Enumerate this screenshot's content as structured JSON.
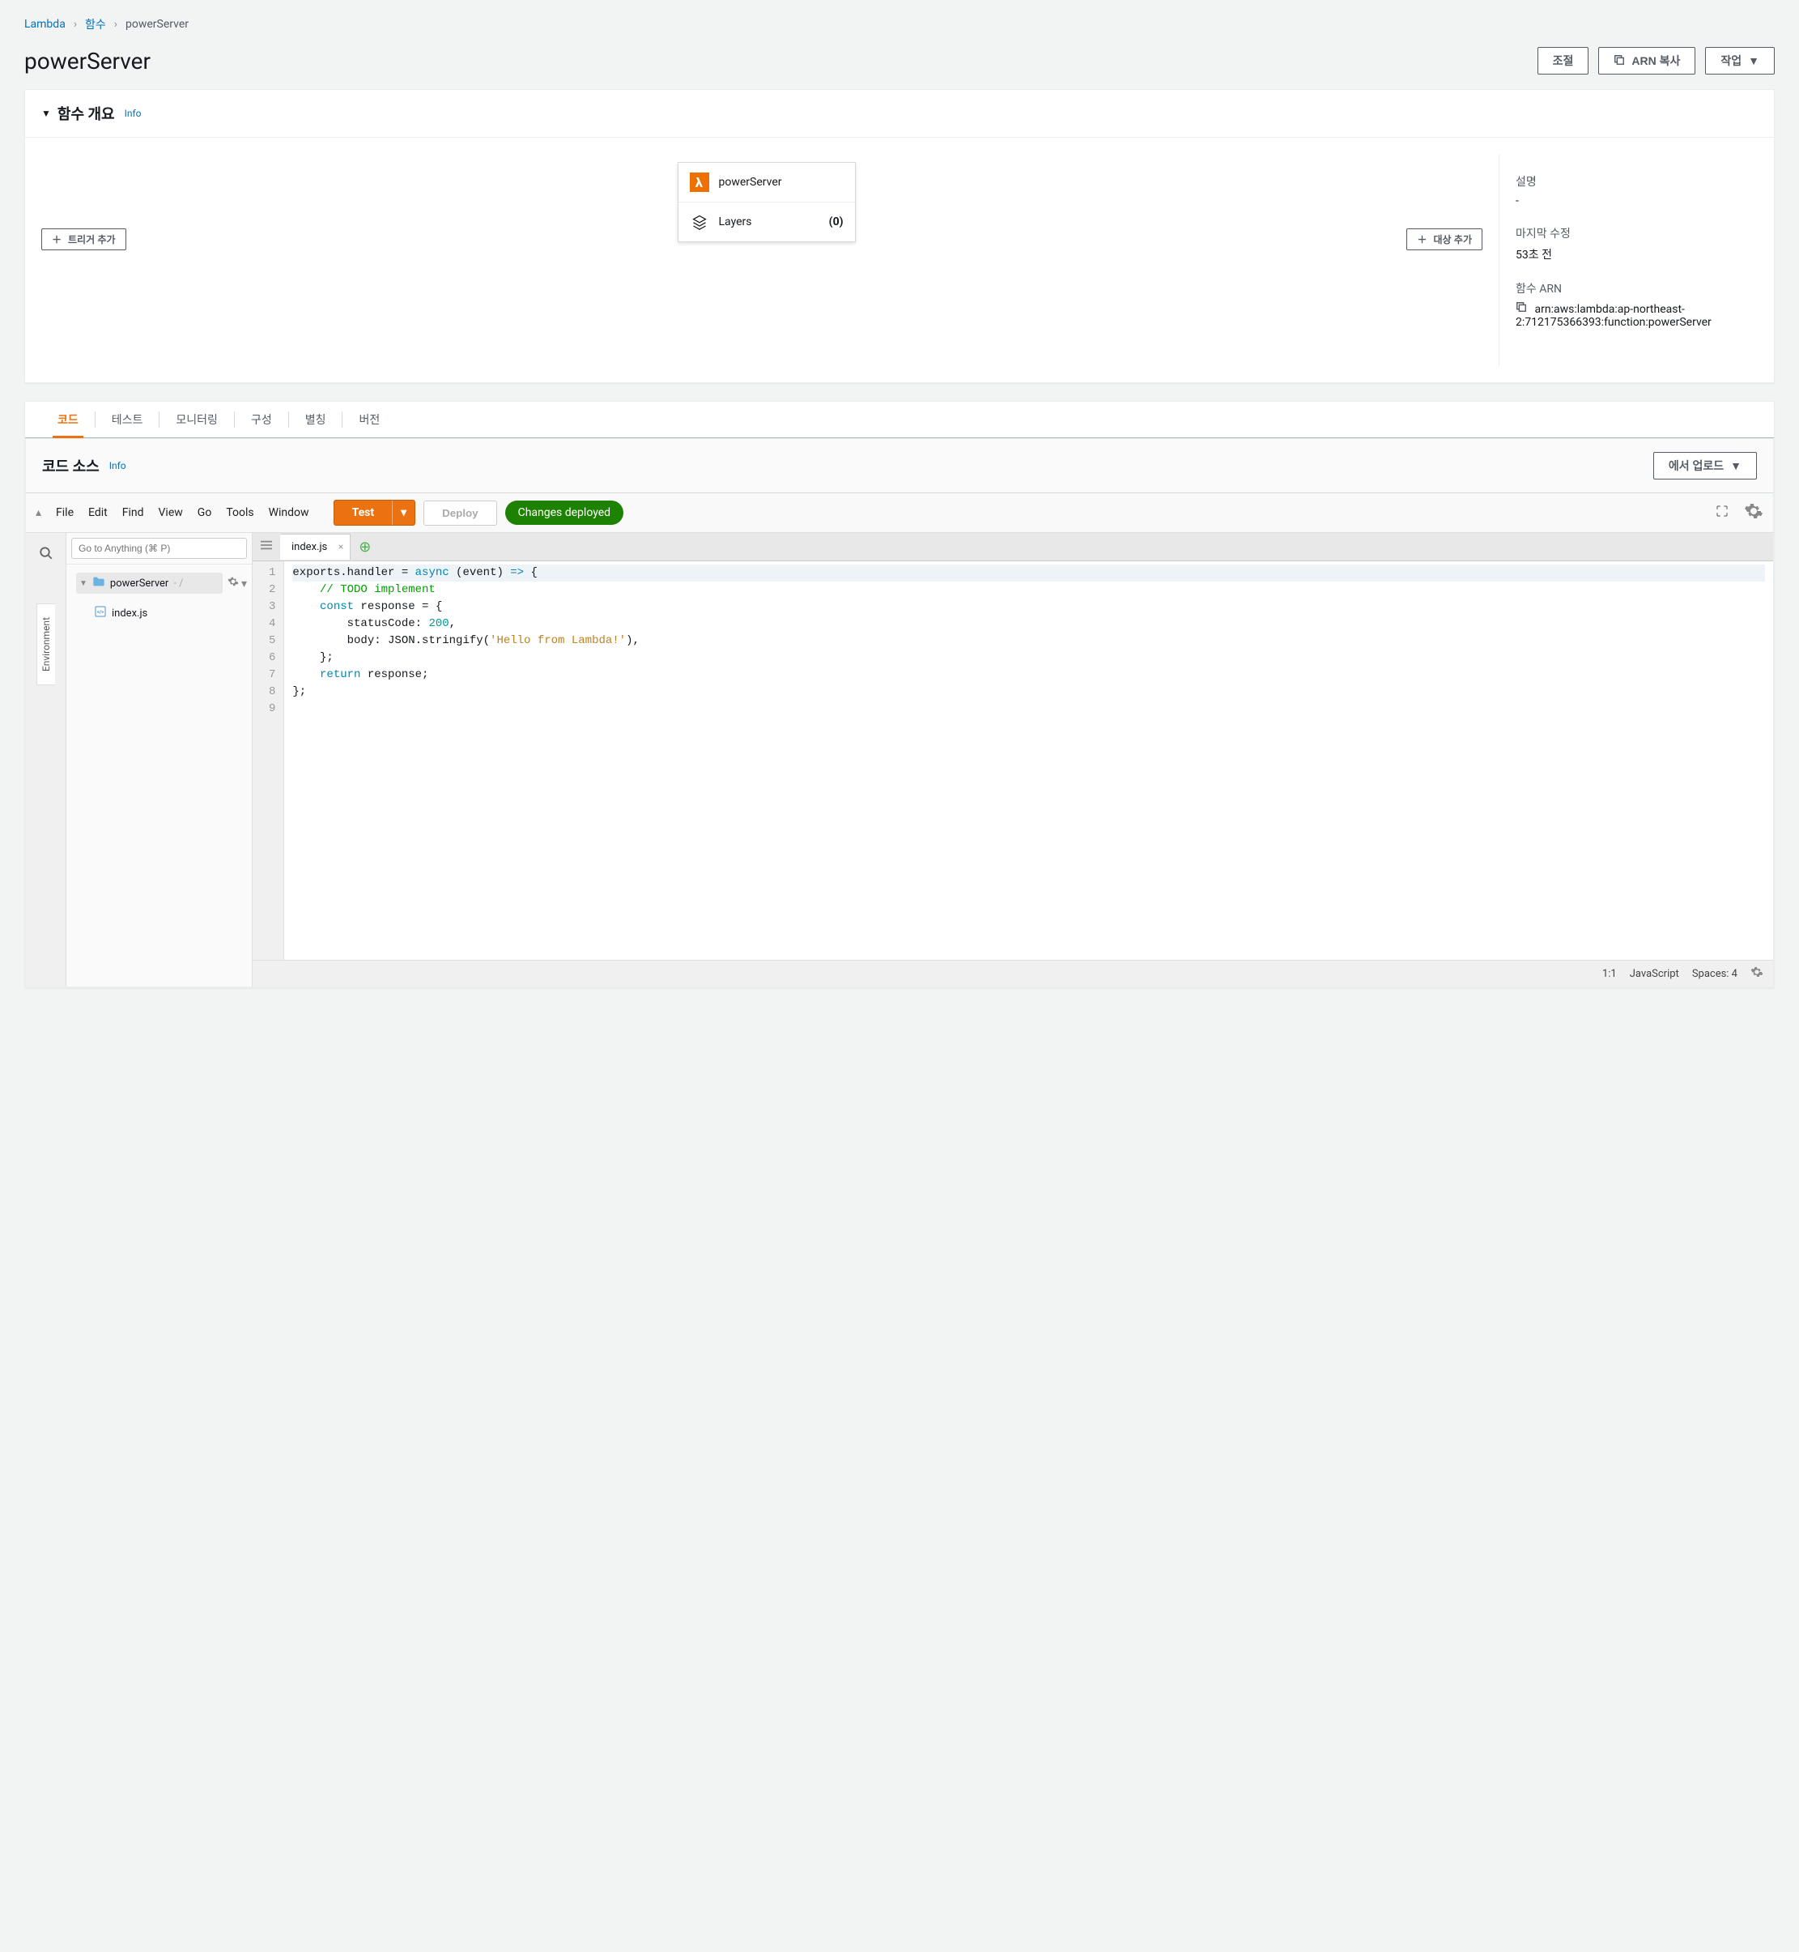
{
  "breadcrumbs": {
    "root": "Lambda",
    "middle": "함수",
    "current": "powerServer"
  },
  "pageTitle": "powerServer",
  "headerButtons": {
    "throttle": "조절",
    "copyArn": "ARN 복사",
    "actions": "작업"
  },
  "overview": {
    "title": "함수 개요",
    "info": "Info",
    "funcName": "powerServer",
    "layersLabel": "Layers",
    "layersCount": "(0)",
    "addTrigger": "트리거 추가",
    "addDestination": "대상 추가",
    "meta": {
      "descLabel": "설명",
      "descValue": "-",
      "lastModLabel": "마지막 수정",
      "lastModValue": "53초 전",
      "arnLabel": "함수 ARN",
      "arnValue": "arn:aws:lambda:ap-northeast-2:712175366393:function:powerServer"
    }
  },
  "tabs": {
    "code": "코드",
    "test": "테스트",
    "monitoring": "모니터링",
    "config": "구성",
    "alias": "별칭",
    "version": "버전"
  },
  "codeSource": {
    "title": "코드 소스",
    "info": "Info",
    "uploadFrom": "에서 업로드"
  },
  "ide": {
    "menu": {
      "file": "File",
      "edit": "Edit",
      "find": "Find",
      "view": "View",
      "go": "Go",
      "tools": "Tools",
      "window": "Window"
    },
    "test": "Test",
    "deploy": "Deploy",
    "changesDeployed": "Changes deployed",
    "sidebarTab": "Environment",
    "searchPlaceholder": "Go to Anything (⌘ P)",
    "tree": {
      "root": "powerServer",
      "rootSuffix": "- /",
      "file": "index.js"
    },
    "editorTab": "index.js",
    "code": {
      "l1a": "exports.handler = ",
      "l1b": "async",
      "l1c": " (event) ",
      "l1d": "=>",
      "l1e": " {",
      "l2": "    // TODO implement",
      "l3a": "    ",
      "l3b": "const",
      "l3c": " response = {",
      "l4a": "        statusCode: ",
      "l4b": "200",
      "l4c": ",",
      "l5a": "        body: JSON.stringify(",
      "l5b": "'Hello from Lambda!'",
      "l5c": "),",
      "l6": "    };",
      "l7a": "    ",
      "l7b": "return",
      "l7c": " response;",
      "l8": "};"
    },
    "statusbar": {
      "pos": "1:1",
      "lang": "JavaScript",
      "spaces": "Spaces: 4"
    }
  }
}
